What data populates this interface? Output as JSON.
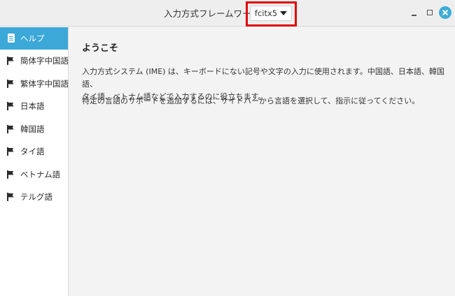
{
  "window": {
    "title": "入力方式フレームワーク",
    "framework_value": "fcitx5"
  },
  "sidebar": {
    "items": [
      {
        "label": "ヘルプ",
        "icon": "help-icon",
        "active": true
      },
      {
        "label": "簡体字中国語",
        "icon": "flag-icon",
        "active": false
      },
      {
        "label": "繁体字中国語",
        "icon": "flag-icon",
        "active": false
      },
      {
        "label": "日本語",
        "icon": "flag-icon",
        "active": false
      },
      {
        "label": "韓国語",
        "icon": "flag-icon",
        "active": false
      },
      {
        "label": "タイ語",
        "icon": "flag-icon",
        "active": false
      },
      {
        "label": "ベトナム語",
        "icon": "flag-icon",
        "active": false
      },
      {
        "label": "テルグ語",
        "icon": "flag-icon",
        "active": false
      }
    ]
  },
  "main": {
    "heading": "ようこそ",
    "para1_line1": "入力方式システム (IME) は、キーボードにない記号や文字の入力に使用されます。中国語、日本語、韓国語、",
    "para1_line2": "タイ語、ベトナム語などで入力するのに役立ちます。",
    "para2": "特定の言語のサポートを追加するには、サイドバーから言語を選択して、指示に従ってください。"
  },
  "colors": {
    "accent": "#3ba8d8",
    "highlight_box": "#e00000",
    "close_button": "#3eacd7"
  }
}
